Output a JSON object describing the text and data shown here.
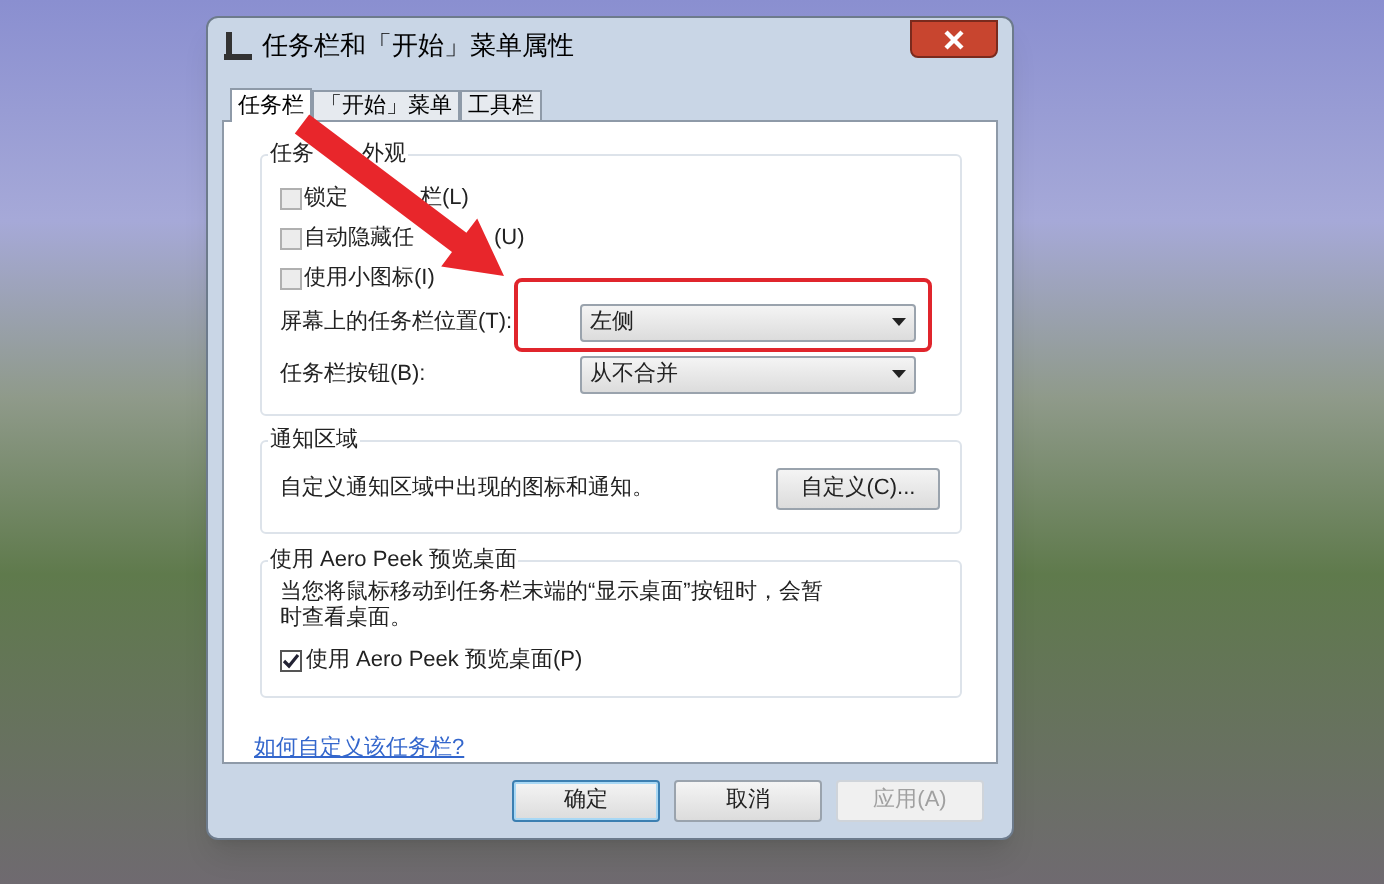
{
  "window": {
    "title": "任务栏和「开始」菜单属性"
  },
  "tabs": [
    {
      "label": "任务栏",
      "selected": true
    },
    {
      "label": "「开始」菜单",
      "selected": false
    },
    {
      "label": "工具栏",
      "selected": false
    }
  ],
  "appearance": {
    "title_parts": [
      "任务",
      "外观"
    ],
    "checkboxes": [
      {
        "label_parts": [
          "锁定",
          "栏(L)"
        ],
        "checked": false
      },
      {
        "label_parts": [
          "自动隐藏任",
          "(U)"
        ],
        "checked": false
      },
      {
        "label_parts": [
          "使用小图标(I)"
        ],
        "checked": false
      }
    ],
    "selects": [
      {
        "label": "屏幕上的任务栏位置(T):",
        "value": "左侧",
        "highlighted": true
      },
      {
        "label": "任务栏按钮(B):",
        "value": "从不合并",
        "highlighted": false
      }
    ]
  },
  "notification_area": {
    "title": "通知区域",
    "text": "自定义通知区域中出现的图标和通知。",
    "button": "自定义(C)..."
  },
  "aero_peek": {
    "title": "使用 Aero Peek 预览桌面",
    "text": "当您将鼠标移动到任务栏末端的“显示桌面”按钮时，会暂时查看桌面。",
    "checkbox": {
      "label": "使用 Aero Peek 预览桌面(P)",
      "checked": true
    }
  },
  "help_link": "如何自定义该任务栏?",
  "buttons": [
    {
      "label": "确定",
      "default": true,
      "disabled": false
    },
    {
      "label": "取消",
      "default": false,
      "disabled": false
    },
    {
      "label": "应用(A)",
      "default": false,
      "disabled": true
    }
  ]
}
